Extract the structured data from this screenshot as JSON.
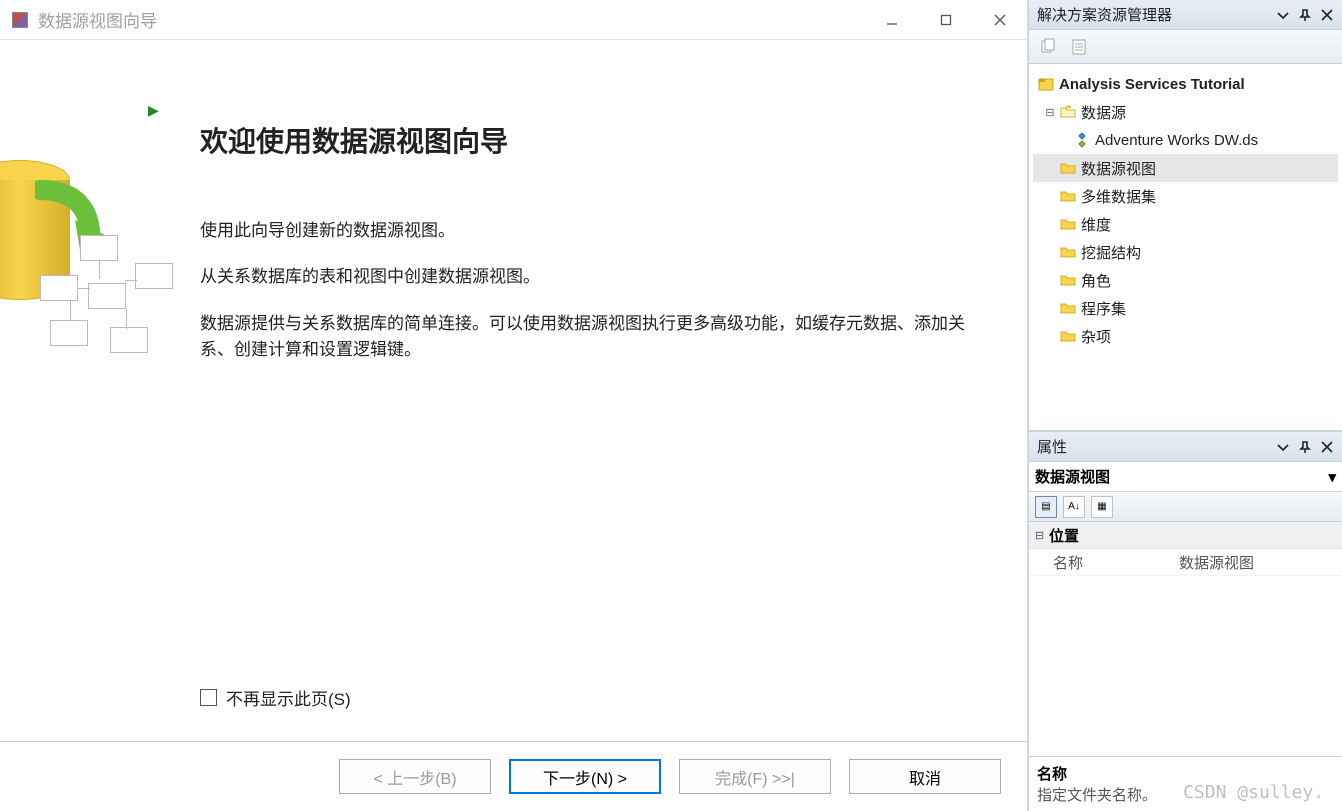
{
  "wizard": {
    "title": "数据源视图向导",
    "heading": "欢迎使用数据源视图向导",
    "paragraphs": [
      "使用此向导创建新的数据源视图。",
      "从关系数据库的表和视图中创建数据源视图。",
      "数据源提供与关系数据库的简单连接。可以使用数据源视图执行更多高级功能，如缓存元数据、添加关系、创建计算和设置逻辑键。"
    ],
    "checkbox_label": "不再显示此页(S)",
    "buttons": {
      "back": "< 上一步(B)",
      "next": "下一步(N) >",
      "finish": "完成(F) >>|",
      "cancel": "取消"
    }
  },
  "solution_explorer": {
    "title": "解决方案资源管理器",
    "root": "Analysis Services Tutorial",
    "nodes": [
      {
        "label": "数据源",
        "children": [
          "Adventure Works DW.ds"
        ]
      },
      {
        "label": "数据源视图",
        "selected": true
      },
      {
        "label": "多维数据集"
      },
      {
        "label": "维度"
      },
      {
        "label": "挖掘结构"
      },
      {
        "label": "角色"
      },
      {
        "label": "程序集"
      },
      {
        "label": "杂项"
      }
    ]
  },
  "properties": {
    "title": "属性",
    "object": "数据源视图",
    "category": "位置",
    "rows": [
      {
        "name": "名称",
        "value": "数据源视图"
      }
    ],
    "help_name": "名称",
    "help_desc": "指定文件夹名称。"
  },
  "watermark": "CSDN @sulley."
}
